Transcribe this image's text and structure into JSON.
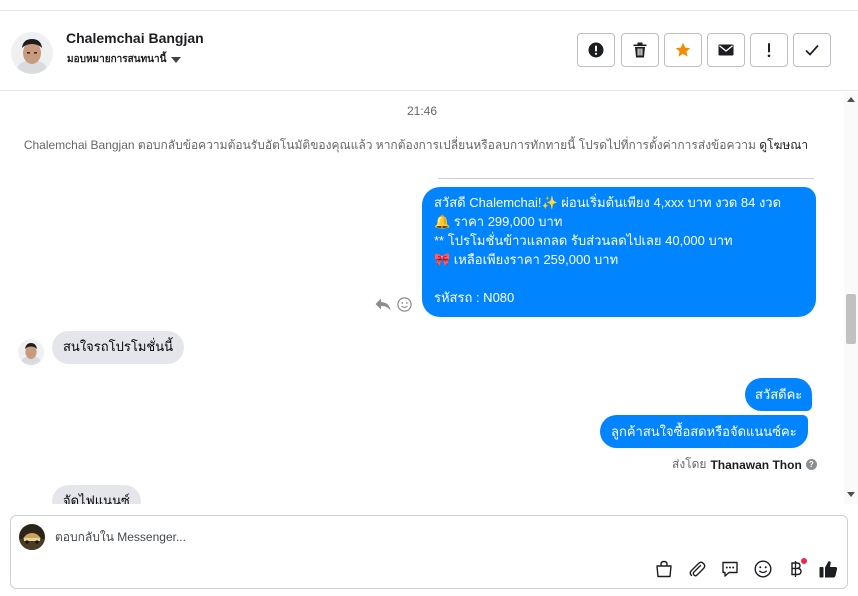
{
  "header": {
    "contact_name": "Chalemchai Bangjan",
    "assign_label": "มอบหมายการสนทนานี้",
    "toolbar": [
      {
        "name": "mark-spam-button",
        "icon": "alert-circle-icon"
      },
      {
        "name": "delete-button",
        "icon": "trash-icon"
      },
      {
        "name": "star-button",
        "icon": "star-icon"
      },
      {
        "name": "mark-unread-button",
        "icon": "envelope-icon"
      },
      {
        "name": "follow-up-button",
        "icon": "exclamation-icon"
      },
      {
        "name": "mark-done-button",
        "icon": "check-icon"
      }
    ]
  },
  "thread": {
    "timestamp": "21:46",
    "auto_reply_notice": "Chalemchai Bangjan ตอบกลับข้อความต้อนรับอัตโนมัติของคุณแล้ว หากต้องการเปลี่ยนหรือลบการทักทายนี้ โปรดไปที่การตั้งค่าการส่งข้อความ",
    "auto_reply_link": "ดูโฆษณา",
    "promo_message": {
      "line1": "สวัสดี Chalemchai!✨  ผ่อนเริ่มต้นเพียง 4,xxx บาท งวด 84 งวด",
      "line2": "🔔 ราคา 299,000 บาท",
      "line3": "** โปรโมชั่นข้าวแลกลด รับส่วนลดไปเลย 40,000 บาท",
      "line4": "🎀  เหลือเพียงราคา 259,000 บาท",
      "line5": " รหัสรถ : N080"
    },
    "incoming_1": "สนใจรถโปรโมชั่นนี้",
    "outgoing_hello": "สวัสดีคะ",
    "outgoing_question": "ลูกค้าสนใจซื้อสดหรือจัดแนนซ์คะ",
    "sent_by_prefix": "ส่งโดย",
    "sent_by_name": "Thanawan Thon",
    "incoming_2": "จัดไฟแนนซ์"
  },
  "composer": {
    "placeholder": "ตอบกลับใน Messenger...",
    "tools": [
      "shopping-bag-icon",
      "paperclip-icon",
      "saved-reply-icon",
      "emoji-icon",
      "baht-payment-icon",
      "thumbs-up-icon"
    ]
  },
  "colors": {
    "outgoing_bubble": "#0084ff",
    "incoming_bubble": "#e4e6eb",
    "star": "#f28b00",
    "notification_dot": "#f02849"
  }
}
